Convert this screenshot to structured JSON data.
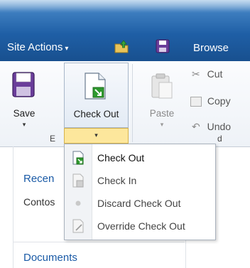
{
  "topbar": {
    "site_actions_label": "Site Actions",
    "site_actions_caret": "▾",
    "browse_label": "Browse"
  },
  "ribbon": {
    "save_label": "Save",
    "checkout_label": "Check Out",
    "paste_label": "Paste",
    "cut_label": "Cut",
    "copy_label": "Copy",
    "undo_label": "Undo",
    "dropdown_arrow": "▾",
    "group_label_left": "E",
    "group_label_right": "d"
  },
  "nav": {
    "recent_label": "Recen",
    "contoso_label": "Contos",
    "documents_label": "Documents"
  },
  "dropdown_menu": {
    "items": [
      {
        "label": "Check Out",
        "enabled": true
      },
      {
        "label": "Check In",
        "enabled": true
      },
      {
        "label": "Discard Check Out",
        "enabled": true
      },
      {
        "label": "Override Check Out",
        "enabled": true
      }
    ]
  },
  "colors": {
    "topbar": "#1f5fa6",
    "link": "#1a5aa6",
    "dropdown_highlight": "#fde79c",
    "save_icon": "#6a3d9a",
    "checkout_arrow": "#2e9a2e"
  }
}
